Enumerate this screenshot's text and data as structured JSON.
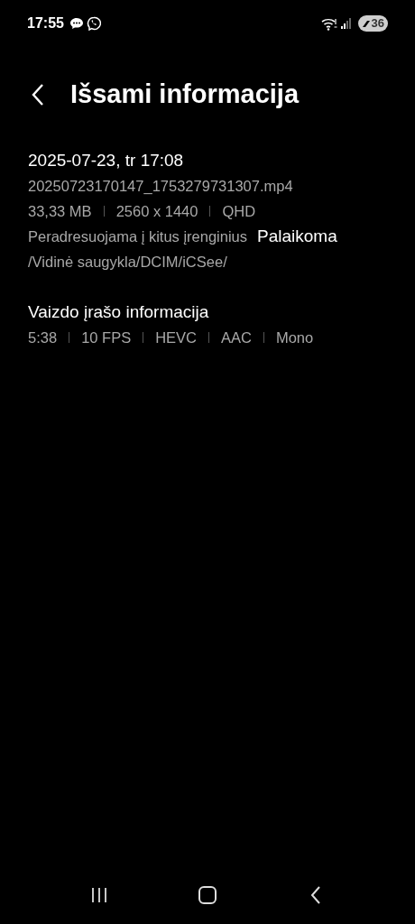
{
  "status_bar": {
    "time": "17:55",
    "battery": "36"
  },
  "header": {
    "title": "Išsami informacija"
  },
  "details": {
    "date": "2025-07-23, tr 17:08",
    "filename": "20250723170147_1753279731307.mp4",
    "specs": [
      "33,33 MB",
      "2560 x 1440",
      "QHD"
    ],
    "forwarding": {
      "label": "Peradresuojama į kitus įrenginius",
      "value": "Palaikoma"
    },
    "path": "/Vidinė saugykla/DCIM/iCSee/"
  },
  "video_info": {
    "title": "Vaizdo įrašo informacija",
    "specs": [
      "5:38",
      "10 FPS",
      "HEVC",
      "AAC",
      "Mono"
    ]
  }
}
